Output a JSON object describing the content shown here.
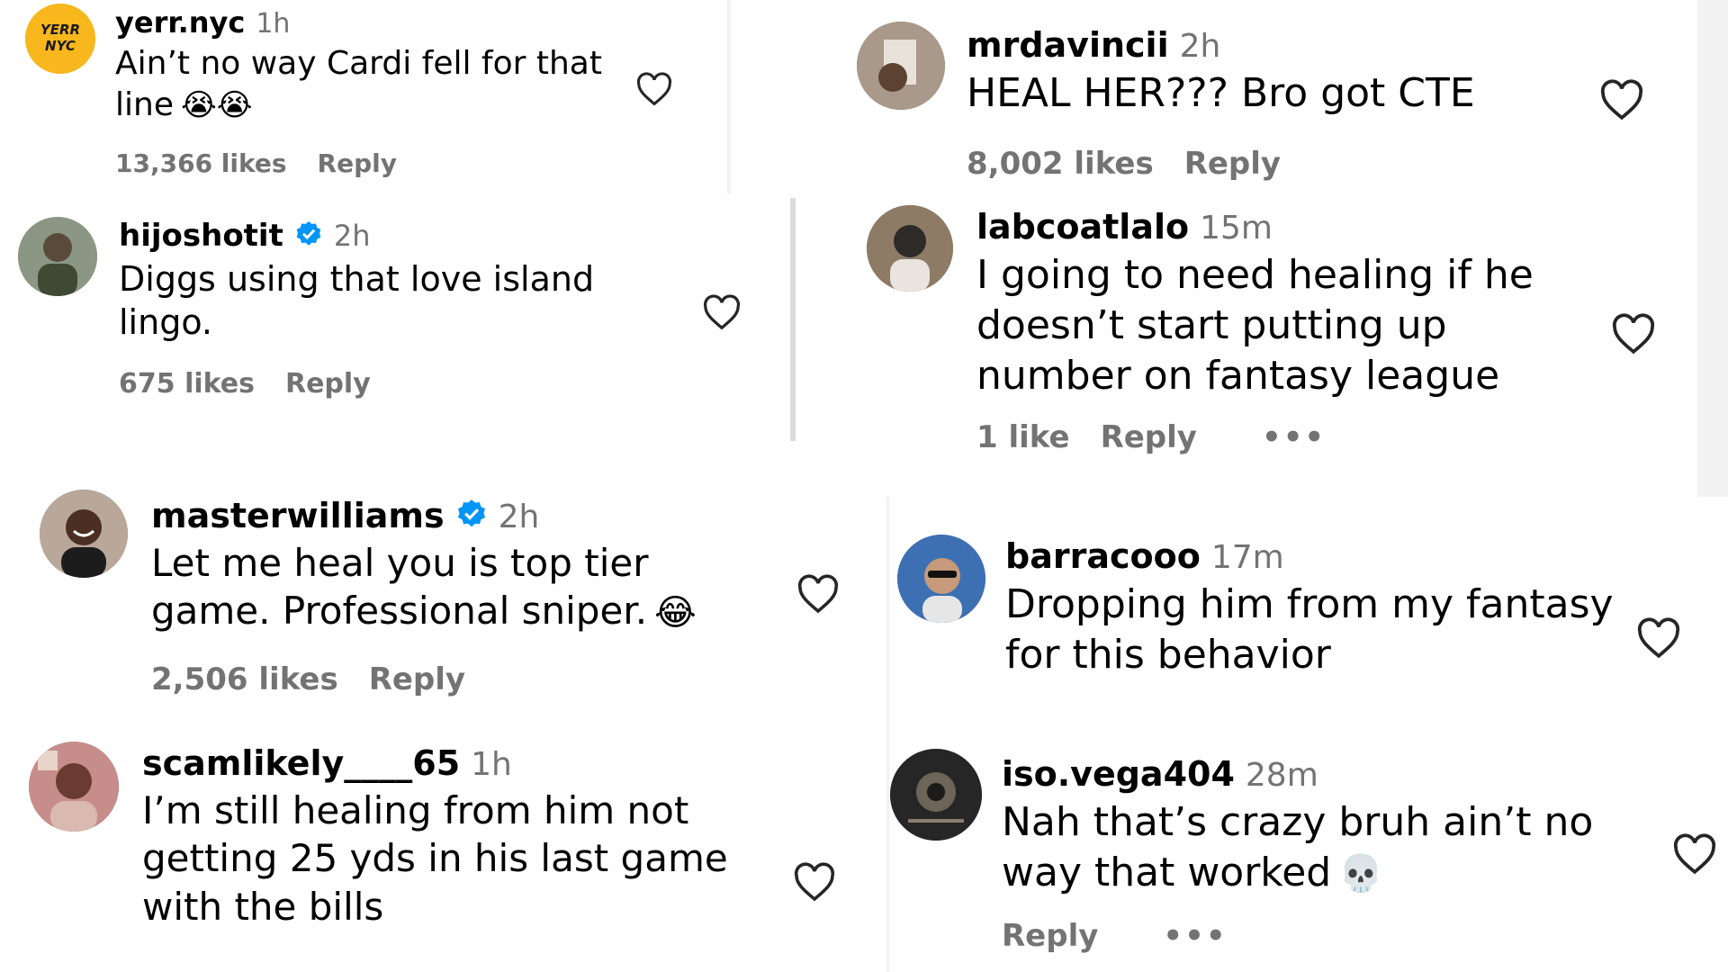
{
  "comments": [
    {
      "username": "yerr.nyc",
      "verified": false,
      "time": "1h",
      "text": "Ain’t no way Cardi fell for that line",
      "emoji": "😭😭",
      "likes": "13,366 likes",
      "reply": "Reply",
      "avatar_logo_text": "YERR NYC"
    },
    {
      "username": "hijoshotit",
      "verified": true,
      "time": "2h",
      "text": "Diggs using that love island lingo.",
      "likes": "675 likes",
      "reply": "Reply"
    },
    {
      "username": "masterwilliams",
      "verified": true,
      "time": "2h",
      "text": "Let me heal you is top tier game. Professional sniper.",
      "emoji": "😂",
      "likes": "2,506 likes",
      "reply": "Reply"
    },
    {
      "username": "scamlikely____65",
      "verified": false,
      "time": "1h",
      "text": "I’m still healing from him not getting 25 yds in his last game with the bills"
    },
    {
      "username": "mrdavincii",
      "verified": false,
      "time": "2h",
      "text": "HEAL HER??? Bro got CTE",
      "likes": "8,002 likes",
      "reply": "Reply"
    },
    {
      "username": "labcoatlalo",
      "verified": false,
      "time": "15m",
      "text": "I going to need healing if he doesn’t start putting up number on fantasy league",
      "likes": "1 like",
      "reply": "Reply",
      "more": "•••"
    },
    {
      "username": "barracooo",
      "verified": false,
      "time": "17m",
      "text": "Dropping him from my fantasy for this behavior"
    },
    {
      "username": "iso.vega404",
      "verified": false,
      "time": "28m",
      "text": "Nah that’s crazy bruh ain’t no way that worked",
      "emoji": "💀",
      "reply": "Reply",
      "more": "•••"
    }
  ],
  "colors": {
    "text": "#000000",
    "muted": "#737373",
    "verified": "#0095f6",
    "heart": "#262626",
    "yerr_bg": "#f7b71d"
  },
  "icons": [
    "heart-outline-icon",
    "verified-badge-icon"
  ]
}
